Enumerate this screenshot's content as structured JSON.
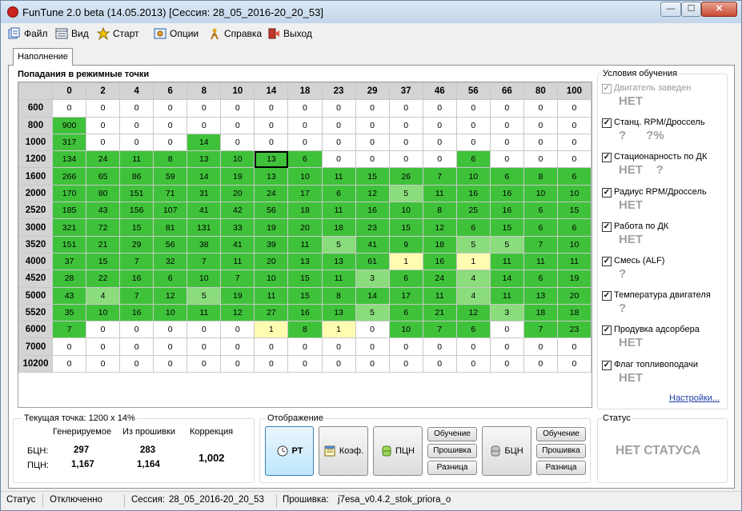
{
  "window": {
    "title": "FunTune 2.0 beta (14.05.2013) [Сессия: 28_05_2016-20_20_53]",
    "min": "—",
    "max": "☐",
    "close": "✕"
  },
  "menu": {
    "file": "Файл",
    "view": "Вид",
    "start": "Старт",
    "options": "Опции",
    "help": "Справка",
    "exit": "Выход"
  },
  "tab": "Наполнение",
  "grid": {
    "title": "Попадания в режимные точки",
    "columns": [
      "0",
      "2",
      "4",
      "6",
      "8",
      "10",
      "14",
      "18",
      "23",
      "29",
      "37",
      "46",
      "56",
      "66",
      "80",
      "100"
    ],
    "rows": [
      {
        "rpm": "600",
        "v": [
          "0",
          "0",
          "0",
          "0",
          "0",
          "0",
          "0",
          "0",
          "0",
          "0",
          "0",
          "0",
          "0",
          "0",
          "0",
          "0"
        ],
        "c": [
          "",
          "",
          "",
          "",
          "",
          "",
          "",
          "",
          "",
          "",
          "",
          "",
          "",
          "",
          "",
          ""
        ]
      },
      {
        "rpm": "800",
        "v": [
          "900",
          "0",
          "0",
          "0",
          "0",
          "0",
          "0",
          "0",
          "0",
          "0",
          "0",
          "0",
          "0",
          "0",
          "0",
          "0"
        ],
        "c": [
          "g",
          "",
          "",
          "",
          "",
          "",
          "",
          "",
          "",
          "",
          "",
          "",
          "",
          "",
          "",
          ""
        ]
      },
      {
        "rpm": "1000",
        "v": [
          "317",
          "0",
          "0",
          "0",
          "14",
          "0",
          "0",
          "0",
          "0",
          "0",
          "0",
          "0",
          "0",
          "0",
          "0",
          "0"
        ],
        "c": [
          "g",
          "",
          "",
          "",
          "g",
          "",
          "",
          "",
          "",
          "",
          "",
          "",
          "",
          "",
          "",
          ""
        ]
      },
      {
        "rpm": "1200",
        "v": [
          "134",
          "24",
          "11",
          "8",
          "13",
          "10",
          "13",
          "6",
          "0",
          "0",
          "0",
          "0",
          "6",
          "0",
          "0",
          "0"
        ],
        "c": [
          "g",
          "g",
          "g",
          "g",
          "g",
          "g",
          "sel",
          "g",
          "",
          "",
          "",
          "",
          "g",
          "",
          "",
          ""
        ]
      },
      {
        "rpm": "1600",
        "v": [
          "266",
          "65",
          "86",
          "59",
          "14",
          "19",
          "13",
          "10",
          "11",
          "15",
          "26",
          "7",
          "10",
          "6",
          "8",
          "6"
        ],
        "c": [
          "g",
          "g",
          "g",
          "g",
          "g",
          "g",
          "g",
          "g",
          "g",
          "g",
          "g",
          "g",
          "g",
          "g",
          "g",
          "g"
        ]
      },
      {
        "rpm": "2000",
        "v": [
          "170",
          "80",
          "151",
          "71",
          "31",
          "20",
          "24",
          "17",
          "6",
          "12",
          "5",
          "11",
          "16",
          "16",
          "10",
          "10"
        ],
        "c": [
          "g",
          "g",
          "g",
          "g",
          "g",
          "g",
          "g",
          "g",
          "g",
          "g",
          "lg",
          "g",
          "g",
          "g",
          "g",
          "g"
        ]
      },
      {
        "rpm": "2520",
        "v": [
          "185",
          "43",
          "156",
          "107",
          "41",
          "42",
          "56",
          "18",
          "11",
          "16",
          "10",
          "8",
          "25",
          "16",
          "6",
          "15"
        ],
        "c": [
          "g",
          "g",
          "g",
          "g",
          "g",
          "g",
          "g",
          "g",
          "g",
          "g",
          "g",
          "g",
          "g",
          "g",
          "g",
          "g"
        ]
      },
      {
        "rpm": "3000",
        "v": [
          "321",
          "72",
          "15",
          "81",
          "131",
          "33",
          "19",
          "20",
          "18",
          "23",
          "15",
          "12",
          "6",
          "15",
          "6",
          "6"
        ],
        "c": [
          "g",
          "g",
          "g",
          "g",
          "g",
          "g",
          "g",
          "g",
          "g",
          "g",
          "g",
          "g",
          "g",
          "g",
          "g",
          "g"
        ]
      },
      {
        "rpm": "3520",
        "v": [
          "151",
          "21",
          "29",
          "56",
          "38",
          "41",
          "39",
          "11",
          "5",
          "41",
          "9",
          "18",
          "5",
          "5",
          "7",
          "10"
        ],
        "c": [
          "g",
          "g",
          "g",
          "g",
          "g",
          "g",
          "g",
          "g",
          "lg",
          "g",
          "g",
          "g",
          "lg",
          "lg",
          "g",
          "g"
        ]
      },
      {
        "rpm": "4000",
        "v": [
          "37",
          "15",
          "7",
          "32",
          "7",
          "11",
          "20",
          "13",
          "13",
          "61",
          "1",
          "16",
          "1",
          "11",
          "11",
          "11"
        ],
        "c": [
          "g",
          "g",
          "g",
          "g",
          "g",
          "g",
          "g",
          "g",
          "g",
          "g",
          "y",
          "g",
          "y",
          "g",
          "g",
          "g"
        ]
      },
      {
        "rpm": "4520",
        "v": [
          "28",
          "22",
          "16",
          "6",
          "10",
          "7",
          "10",
          "15",
          "11",
          "3",
          "6",
          "24",
          "4",
          "14",
          "6",
          "19"
        ],
        "c": [
          "g",
          "g",
          "g",
          "g",
          "g",
          "g",
          "g",
          "g",
          "g",
          "lg",
          "g",
          "g",
          "lg",
          "g",
          "g",
          "g"
        ]
      },
      {
        "rpm": "5000",
        "v": [
          "43",
          "4",
          "7",
          "12",
          "5",
          "19",
          "11",
          "15",
          "8",
          "14",
          "17",
          "11",
          "4",
          "11",
          "13",
          "20"
        ],
        "c": [
          "g",
          "lg",
          "g",
          "g",
          "lg",
          "g",
          "g",
          "g",
          "g",
          "g",
          "g",
          "g",
          "lg",
          "g",
          "g",
          "g"
        ]
      },
      {
        "rpm": "5520",
        "v": [
          "35",
          "10",
          "16",
          "10",
          "11",
          "12",
          "27",
          "16",
          "13",
          "5",
          "6",
          "21",
          "12",
          "3",
          "18",
          "18"
        ],
        "c": [
          "g",
          "g",
          "g",
          "g",
          "g",
          "g",
          "g",
          "g",
          "g",
          "lg",
          "g",
          "g",
          "g",
          "lg",
          "g",
          "g"
        ]
      },
      {
        "rpm": "6000",
        "v": [
          "7",
          "0",
          "0",
          "0",
          "0",
          "0",
          "1",
          "8",
          "1",
          "0",
          "10",
          "7",
          "6",
          "0",
          "7",
          "23"
        ],
        "c": [
          "g",
          "",
          "",
          "",
          "",
          "",
          "y",
          "g",
          "y",
          "",
          "g",
          "g",
          "g",
          "",
          "g",
          "g"
        ]
      },
      {
        "rpm": "7000",
        "v": [
          "0",
          "0",
          "0",
          "0",
          "0",
          "0",
          "0",
          "0",
          "0",
          "0",
          "0",
          "0",
          "0",
          "0",
          "0",
          "0"
        ],
        "c": [
          "",
          "",
          "",
          "",
          "",
          "",
          "",
          "",
          "",
          "",
          "",
          "",
          "",
          "",
          "",
          ""
        ]
      },
      {
        "rpm": "10200",
        "v": [
          "0",
          "0",
          "0",
          "0",
          "0",
          "0",
          "0",
          "0",
          "0",
          "0",
          "0",
          "0",
          "0",
          "0",
          "0",
          "0"
        ],
        "c": [
          "",
          "",
          "",
          "",
          "",
          "",
          "",
          "",
          "",
          "",
          "",
          "",
          "",
          "",
          "",
          ""
        ]
      }
    ]
  },
  "conditions": {
    "title": "Условия обучения",
    "items": [
      {
        "label": "Двигатель заведен",
        "checked": true,
        "disabled": true,
        "status": "НЕТ"
      },
      {
        "label": "Станц. RPM/Дроссель",
        "checked": true,
        "disabled": false,
        "status": "?      ?%"
      },
      {
        "label": "Стационарность по ДК",
        "checked": true,
        "disabled": false,
        "status": "НЕТ    ?"
      },
      {
        "label": "Радиус RPM/Дроссель",
        "checked": true,
        "disabled": false,
        "status": "НЕТ"
      },
      {
        "label": "Работа по ДК",
        "checked": true,
        "disabled": false,
        "status": "НЕТ"
      },
      {
        "label": "Смесь (ALF)",
        "checked": true,
        "disabled": false,
        "status": "?"
      },
      {
        "label": "Температура двигателя",
        "checked": true,
        "disabled": false,
        "status": "?"
      },
      {
        "label": "Продувка адсорбера",
        "checked": true,
        "disabled": false,
        "status": "НЕТ"
      },
      {
        "label": "Флаг топливоподачи",
        "checked": true,
        "disabled": false,
        "status": "НЕТ"
      }
    ],
    "settings_link": "Настройки..."
  },
  "current_point": {
    "title": "Текущая точка: 1200 x 14%",
    "col_generated": "Генерируемое",
    "col_firmware": "Из прошивки",
    "col_correction": "Коррекция",
    "row_bcn": "БЦН:",
    "row_pcn": "ПЦН:",
    "bcn_generated": "297",
    "bcn_firmware": "283",
    "pcn_generated": "1,167",
    "pcn_firmware": "1,164",
    "correction": "1,002"
  },
  "display": {
    "title": "Отображение",
    "rt": "РТ",
    "coef": "Коэф.",
    "pcn": "ПЦН",
    "bcn": "БЦН",
    "learn1": "Обучение",
    "firmware1": "Прошивка",
    "diff1": "Разница",
    "learn2": "Обучение",
    "firmware2": "Прошивка",
    "diff2": "Разница"
  },
  "status_box": {
    "title": "Статус",
    "value": "НЕТ СТАТУСА"
  },
  "statusbar": {
    "status": "Статус",
    "state": "Отключенно",
    "session_label": "Сессия:",
    "session": "28_05_2016-20_20_53",
    "firmware_label": "Прошивка:",
    "firmware": "j7esa_v0.4.2_stok_priora_o"
  },
  "colors": {
    "hit_high": "#3fc23a",
    "hit_mid": "#8bdc7c",
    "hit_low": "#fdfcb0"
  }
}
